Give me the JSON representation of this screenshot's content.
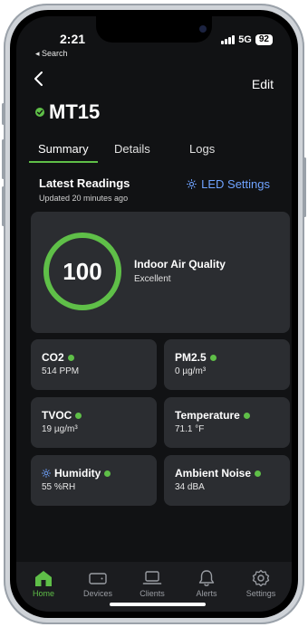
{
  "status_bar": {
    "time": "2:21",
    "back_label": "◂ Search",
    "network": "5G",
    "battery": "92"
  },
  "header": {
    "edit_label": "Edit",
    "device_name": "MT15"
  },
  "tabs": [
    {
      "label": "Summary",
      "active": true
    },
    {
      "label": "Details",
      "active": false
    },
    {
      "label": "Logs",
      "active": false
    }
  ],
  "readings": {
    "title": "Latest Readings",
    "updated": "Updated 20 minutes ago",
    "led_settings_label": "LED Settings"
  },
  "air_quality": {
    "score": "100",
    "label": "Indoor Air Quality",
    "status": "Excellent"
  },
  "metrics": [
    {
      "name": "CO2",
      "value": "514 PPM"
    },
    {
      "name": "PM2.5",
      "value": "0 µg/m³"
    },
    {
      "name": "TVOC",
      "value": "19 µg/m³"
    },
    {
      "name": "Temperature",
      "value": "71.1 °F"
    },
    {
      "name": "Humidity",
      "value": "55 %RH"
    },
    {
      "name": "Ambient Noise",
      "value": "34 dBA"
    }
  ],
  "nav": [
    {
      "label": "Home",
      "icon": "home-icon"
    },
    {
      "label": "Devices",
      "icon": "devices-icon"
    },
    {
      "label": "Clients",
      "icon": "clients-icon"
    },
    {
      "label": "Alerts",
      "icon": "bell-icon"
    },
    {
      "label": "Settings",
      "icon": "gear-icon"
    }
  ],
  "colors": {
    "accent_green": "#5fbf48",
    "link_blue": "#6fa3ff",
    "background": "#111214",
    "card": "#2b2d31"
  }
}
